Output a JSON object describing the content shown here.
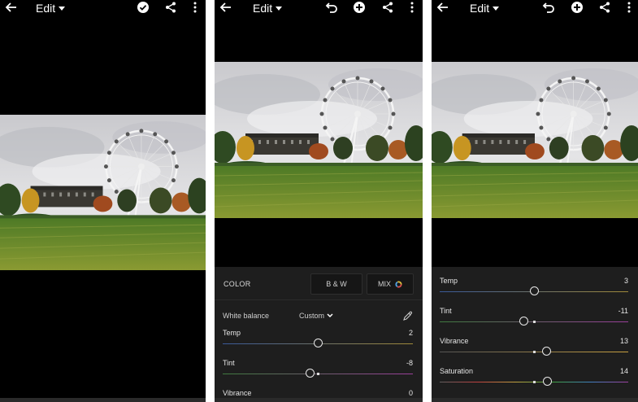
{
  "common": {
    "edit_label": "Edit"
  },
  "screen2": {
    "panel": {
      "color_label": "COLOR",
      "bw_label": "B & W",
      "mix_label": "MIX",
      "white_balance_label": "White balance",
      "white_balance_value": "Custom"
    },
    "sliders": [
      {
        "name": "Temp",
        "value": "2",
        "level": 0.5
      },
      {
        "name": "Tint",
        "value": "-8",
        "level": 0.46
      },
      {
        "name": "Vibrance",
        "value": "0",
        "level": 0.5
      }
    ]
  },
  "screen3": {
    "sliders": [
      {
        "name": "Temp",
        "value": "3",
        "level": 0.5
      },
      {
        "name": "Tint",
        "value": "-11",
        "level": 0.445
      },
      {
        "name": "Vibrance",
        "value": "13",
        "level": 0.565
      },
      {
        "name": "Saturation",
        "value": "14",
        "level": 0.57
      }
    ]
  },
  "colors": {
    "temp_start": "#3a5a9a",
    "temp_end": "#a08a3a",
    "tint_start": "#3f7a3f",
    "tint_end": "#9a3f9a",
    "vibrance_start": "#555555",
    "vibrance_end": "#c8a040"
  }
}
